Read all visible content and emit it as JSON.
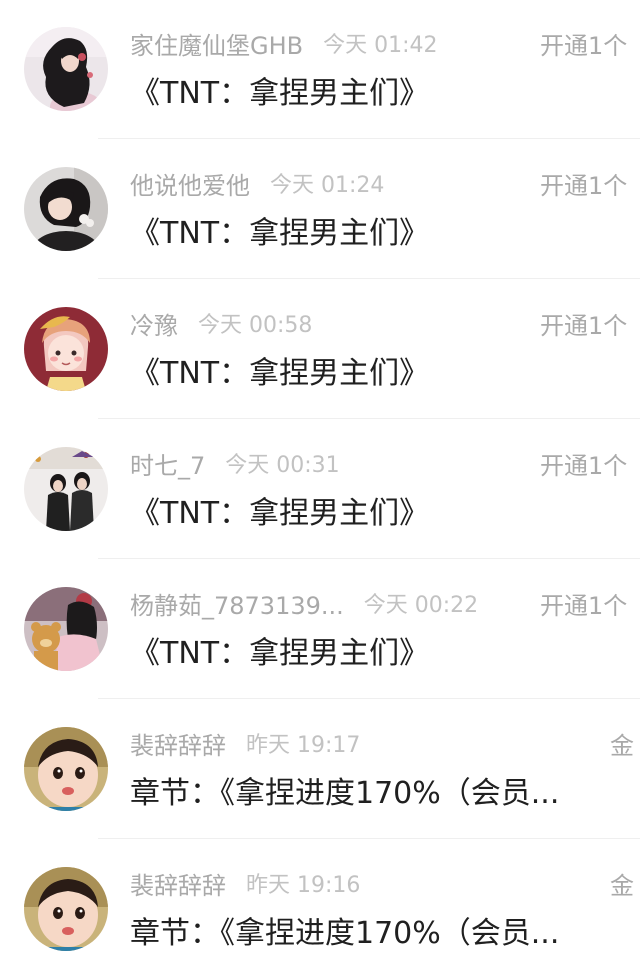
{
  "messages": [
    {
      "name": "家住魔仙堡GHB",
      "time": "今天 01:42",
      "action": "开通1个",
      "content": "《TNT：拿捏男主们》",
      "avatar": "girl-long-hair-avatar"
    },
    {
      "name": "他说他爱他",
      "time": "今天 01:24",
      "action": "开通1个",
      "content": "《TNT：拿捏男主们》",
      "avatar": "girl-portrait-avatar"
    },
    {
      "name": "冷豫",
      "time": "今天 00:58",
      "action": "开通1个",
      "content": "《TNT：拿捏男主们》",
      "avatar": "cartoon-girl-avatar"
    },
    {
      "name": "时七_7",
      "time": "今天 00:31",
      "action": "开通1个",
      "content": "《TNT：拿捏男主们》",
      "avatar": "couple-photo-avatar"
    },
    {
      "name": "杨静茹_7873139...",
      "time": "今天 00:22",
      "action": "开通1个",
      "content": "《TNT：拿捏男主们》",
      "avatar": "girl-teddy-bear-avatar"
    },
    {
      "name": "裴辞辞辞",
      "time": "昨天 19:17",
      "action": "金",
      "content": "章节：《拿捏进度170%（会员...",
      "avatar": "baby-face-avatar"
    },
    {
      "name": "裴辞辞辞",
      "time": "昨天 19:16",
      "action": "金",
      "content": "章节：《拿捏进度170%（会员...",
      "avatar": "baby-face-avatar"
    }
  ]
}
